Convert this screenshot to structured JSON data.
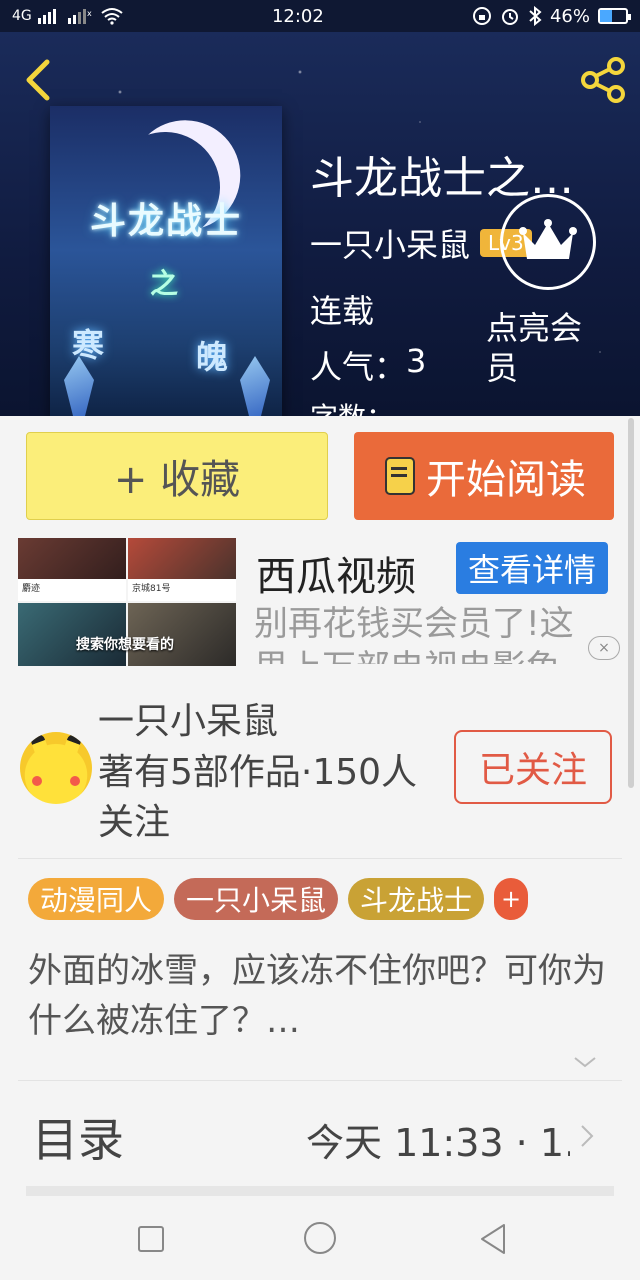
{
  "status_bar": {
    "network": "4G",
    "time": "12:02",
    "battery_percent": "46%",
    "battery_level": 0.46
  },
  "book": {
    "title": "斗龙战士之…",
    "author": "一只小呆鼠",
    "level_badge": "Lv3",
    "serial_status": "连载",
    "popularity_label": "人气：",
    "popularity_value": "3",
    "wordcount_label": "字数：",
    "vip_text": "点亮会员",
    "cover": {
      "line1": "斗龙战士",
      "line2": "之",
      "line3a": "寒",
      "line3b": "魄"
    }
  },
  "actions": {
    "favorite_label": "+ 收藏",
    "read_label": "开始阅读"
  },
  "ad": {
    "title": "西瓜视频",
    "button_label": "查看详情",
    "description": "别再花钱买会员了!这里上万部电视电影免",
    "thumb_caption_1": "麝迹",
    "thumb_caption_2": "京城81号",
    "thumb_search_caption": "搜索你想要看的",
    "close_label": "×"
  },
  "author_section": {
    "name": "一只小呆鼠",
    "works_summary": "著有5部作品·150人关注",
    "follow_label": "已关注"
  },
  "tags": [
    {
      "label": "动漫同人",
      "color": "#f3a93a"
    },
    {
      "label": "一只小呆鼠",
      "color": "#c46a58"
    },
    {
      "label": "斗龙战士",
      "color": "#c9a235"
    }
  ],
  "tag_add_label": "+",
  "synopsis": "外面的冰雪，应该冻不住你吧？可你为什么被冻住了？…",
  "toc": {
    "title": "目录",
    "latest": "今天 11:33 · 1."
  },
  "colors": {
    "read_button": "#ea6a3a",
    "favorite_button": "#fbee7a",
    "ad_button": "#2a7de1",
    "follow_accent": "#e15a45"
  }
}
